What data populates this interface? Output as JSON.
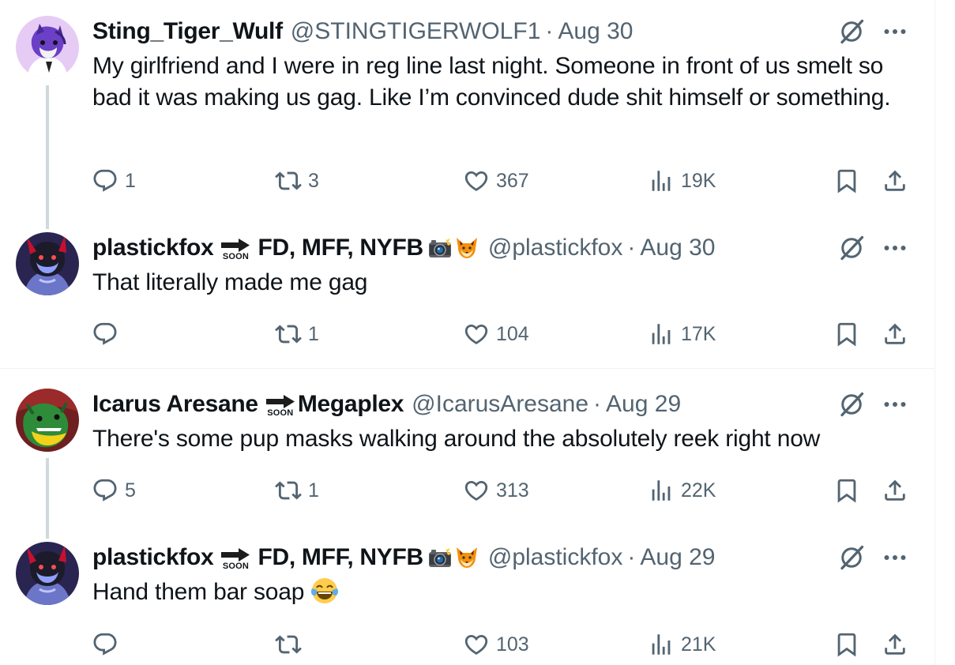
{
  "tweets": [
    {
      "name": "Sting_Tiger_Wulf",
      "name_suffix": "",
      "handle": "@STINGTIGERWOLF1",
      "date": "Aug 30",
      "text": "My girlfriend and I were in reg line last night. Someone in front of us smelt so bad it was making us gag. Like I’m convinced dude shit himself or something.",
      "replies": "1",
      "reposts": "3",
      "likes": "367",
      "views": "19K"
    },
    {
      "name": "plastickfox",
      "soon_label": "SOON",
      "name_suffix": "FD, MFF, NYFB",
      "handle": "@plastickfox",
      "date": "Aug 30",
      "text": "That literally made me gag",
      "replies": "",
      "reposts": "1",
      "likes": "104",
      "views": "17K"
    },
    {
      "name": "Icarus Aresane",
      "soon_label": "SOON",
      "name_suffix": "Megaplex",
      "handle": "@IcarusAresane",
      "date": "Aug 29",
      "text": "There's some pup masks walking around the absolutely reek right now",
      "replies": "5",
      "reposts": "1",
      "likes": "313",
      "views": "22K"
    },
    {
      "name": "plastickfox",
      "soon_label": "SOON",
      "name_suffix": "FD, MFF, NYFB",
      "handle": "@plastickfox",
      "date": "Aug 29",
      "text": "Hand them bar soap",
      "replies": "",
      "reposts": "",
      "likes": "103",
      "views": "21K"
    }
  ],
  "separator": "·",
  "icons": {
    "reply": "reply-icon",
    "repost": "repost-icon",
    "like": "heart-icon",
    "views": "views-icon",
    "bookmark": "bookmark-icon",
    "share": "share-icon",
    "grok": "grok-icon",
    "more": "more-icon",
    "camera_flash": "camera-flash-emoji",
    "fox": "fox-emoji",
    "laughing": "tears-of-joy-emoji"
  },
  "colors": {
    "text_primary": "#0f1419",
    "text_secondary": "#536471",
    "thread_line": "#cfd9de",
    "divider": "#eff3f4"
  }
}
